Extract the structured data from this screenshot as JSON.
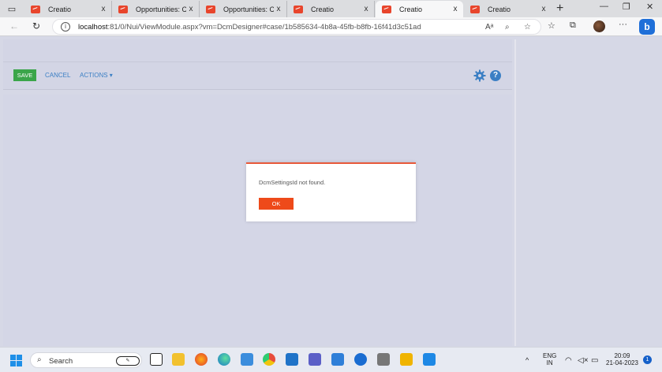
{
  "browser": {
    "tabs": [
      {
        "title": "Creatio",
        "active": false
      },
      {
        "title": "Opportunities: Case",
        "active": false
      },
      {
        "title": "Opportunities: Case",
        "active": false
      },
      {
        "title": "Creatio",
        "active": false
      },
      {
        "title": "Creatio",
        "active": true
      },
      {
        "title": "Creatio",
        "active": false
      }
    ],
    "close_glyph": "x",
    "new_tab_glyph": "+",
    "url_host": "localhost",
    "url_rest": ":81/0/Nui/ViewModule.aspx?vm=DcmDesigner#case/1b585634-4b8a-45fb-b8fb-16f41d3c51ad"
  },
  "toolbar": {
    "save_label": "SAVE",
    "cancel_label": "CANCEL",
    "actions_label": "ACTIONS",
    "help_label": "?"
  },
  "dialog": {
    "message": "DcmSettingsId not found.",
    "ok_label": "OK"
  },
  "taskbar": {
    "search_placeholder": "Search",
    "language": "ENG",
    "region": "IN",
    "time": "20:09",
    "date": "21-04-2023",
    "notification_count": "1"
  },
  "colors": {
    "save": "#3ba54a",
    "link": "#3b7fc4",
    "ok": "#ee4a1a",
    "dialog_accent": "#e8593a",
    "favicon": "#e8452c"
  }
}
